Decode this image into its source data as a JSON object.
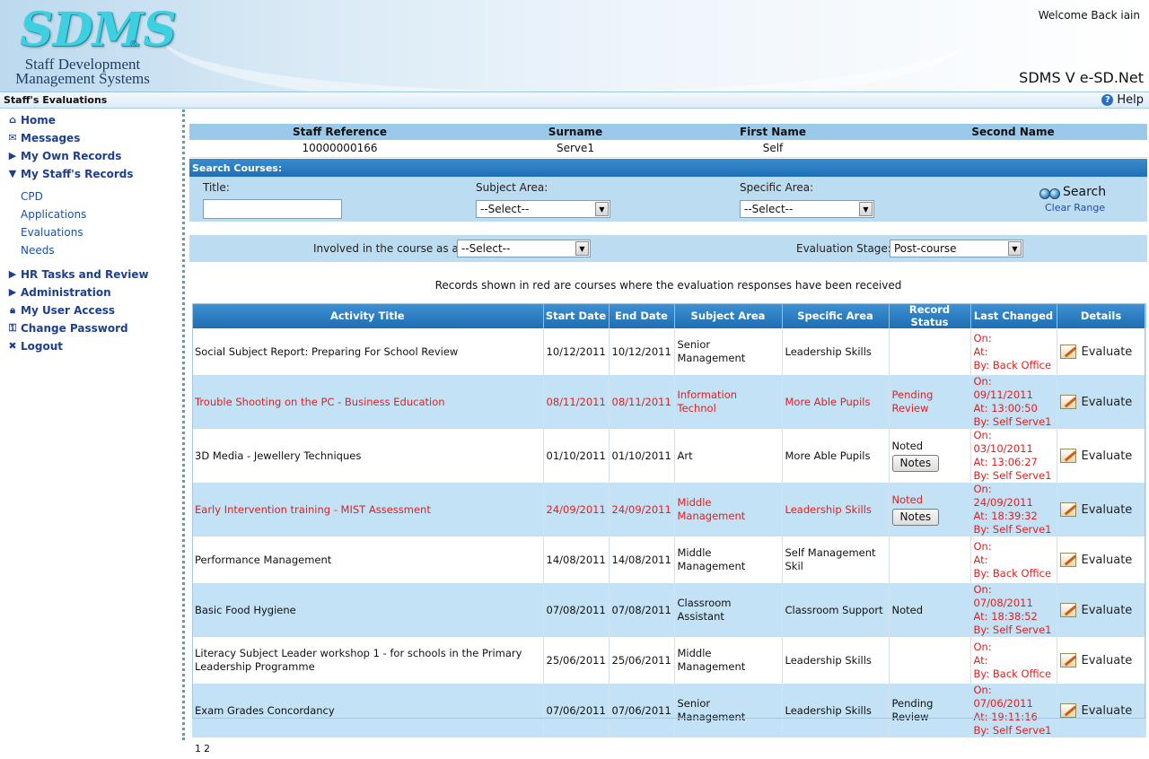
{
  "header": {
    "logo_mark": "SDMS",
    "logo_reg": "®",
    "logo_line1": "Staff Development",
    "logo_line2": "Management Systems",
    "welcome": "Welcome Back iain",
    "version": "SDMS V e-SD.Net"
  },
  "titlebar": {
    "title": "Staff's Evaluations",
    "help": "Help"
  },
  "sidebar": {
    "home": "Home",
    "messages": "Messages",
    "own_records": "My Own Records",
    "staff_records": "My Staff's Records",
    "sub": [
      "CPD",
      "Applications",
      "Evaluations",
      "Needs"
    ],
    "hr": "HR Tasks and Review",
    "admin": "Administration",
    "user_access": "My User Access",
    "change_password": "Change Password",
    "logout": "Logout"
  },
  "staff": {
    "headers": [
      "Staff Reference",
      "Surname",
      "First Name",
      "Second Name"
    ],
    "values": [
      "10000000166",
      "Serve1",
      "Self",
      ""
    ]
  },
  "search": {
    "bar_label": "Search Courses:",
    "title_label": "Title:",
    "title_value": "",
    "subject_label": "Subject Area:",
    "subject_value": "--Select--",
    "specific_label": "Specific Area:",
    "specific_value": "--Select--",
    "search_button": "Search",
    "clear_range": "Clear Range"
  },
  "filters": {
    "involved_label": "Involved in the course as a:",
    "involved_value": "--Select--",
    "stage_label": "Evaluation Stage:",
    "stage_value": "Post-course"
  },
  "notice": "Records shown in red are courses where the evaluation responses have been received",
  "table": {
    "columns": [
      "Activity Title",
      "Start Date",
      "End Date",
      "Subject Area",
      "Specific Area",
      "Record Status",
      "Last Changed",
      "Details"
    ],
    "evaluate_label": "Evaluate",
    "notes_label": "Notes",
    "rows": [
      {
        "title": "Social Subject Report: Preparing For School Review",
        "start": "10/12/2011",
        "end": "10/12/2011",
        "subject": "Senior Management",
        "specific": "Leadership Skills",
        "status": "",
        "notes": false,
        "on": "On:",
        "at": "At:",
        "by": "By: Back Office"
      },
      {
        "title": "Trouble Shooting on the PC - Business Education",
        "start": "08/11/2011",
        "end": "08/11/2011",
        "subject": "Information Technol",
        "specific": "More Able Pupils",
        "status": "Pending Review",
        "notes": false,
        "on": "On: 09/11/2011",
        "at": "At: 13:00:50",
        "by": "By: Self Serve1"
      },
      {
        "title": "3D Media - Jewellery Techniques",
        "start": "01/10/2011",
        "end": "01/10/2011",
        "subject": "Art",
        "specific": "More Able Pupils",
        "status": "Noted",
        "notes": true,
        "on": "On: 03/10/2011",
        "at": "At: 13:06:27",
        "by": "By: Self Serve1"
      },
      {
        "title": "Early Intervention training - MIST Assessment",
        "start": "24/09/2011",
        "end": "24/09/2011",
        "subject": "Middle Management",
        "specific": "Leadership Skills",
        "status": "Noted",
        "notes": true,
        "on": "On: 24/09/2011",
        "at": "At: 18:39:32",
        "by": "By: Self Serve1"
      },
      {
        "title": "Performance Management",
        "start": "14/08/2011",
        "end": "14/08/2011",
        "subject": "Middle Management",
        "specific": "Self Management Skil",
        "status": "",
        "notes": false,
        "on": "On:",
        "at": "At:",
        "by": "By: Back Office"
      },
      {
        "title": "Basic Food Hygiene",
        "start": "07/08/2011",
        "end": "07/08/2011",
        "subject": "Classroom Assistant",
        "specific": "Classroom Support",
        "status": "Noted",
        "notes": false,
        "on": "On: 07/08/2011",
        "at": "At: 18:38:52",
        "by": "By: Self Serve1"
      },
      {
        "title": "Literacy Subject Leader workshop 1 - for schools in the Primary Leadership Programme",
        "start": "25/06/2011",
        "end": "25/06/2011",
        "subject": "Middle Management",
        "specific": "Leadership Skills",
        "status": "",
        "notes": false,
        "on": "On:",
        "at": "At:",
        "by": "By: Back Office"
      },
      {
        "title": "Exam Grades Concordancy",
        "start": "07/06/2011",
        "end": "07/06/2011",
        "subject": "Senior Management",
        "specific": "Leadership Skills",
        "status": "Pending Review",
        "notes": false,
        "on": "On: 07/06/2011",
        "at": "At: 19:11:16",
        "by": "By: Self Serve1"
      }
    ],
    "pages": [
      "1",
      "2"
    ]
  }
}
